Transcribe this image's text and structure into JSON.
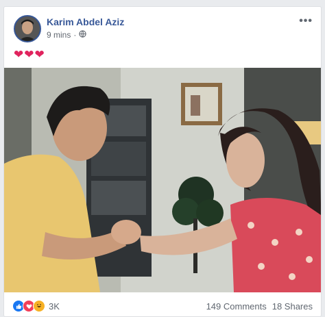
{
  "post": {
    "author": "Karim Abdel Aziz",
    "time": "9 mins",
    "privacy_separator": "·",
    "privacy_icon": "globe-icon",
    "more_label": "•••",
    "caption": "❤❤❤",
    "reactions": {
      "icons": [
        "like-icon",
        "love-icon",
        "haha-icon"
      ],
      "count": "3K"
    },
    "comments": "149 Comments",
    "shares": "18 Shares"
  },
  "colors": {
    "author": "#385898",
    "background": "#e9ebee",
    "like": "#1877f2",
    "love": "#f33e58",
    "haha": "#f7b125"
  }
}
